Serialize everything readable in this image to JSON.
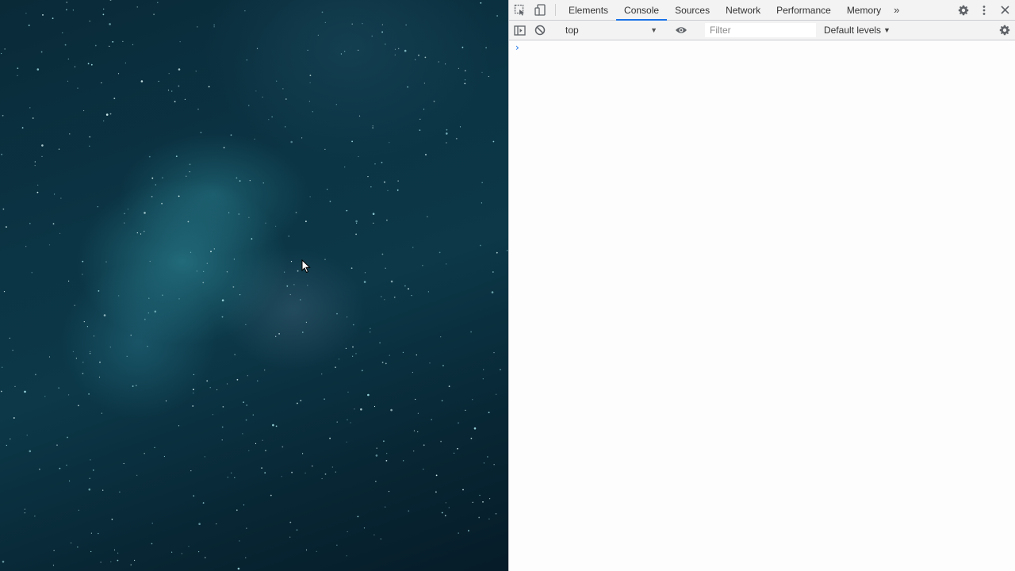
{
  "devtools": {
    "tabs": [
      {
        "label": "Elements"
      },
      {
        "label": "Console"
      },
      {
        "label": "Sources"
      },
      {
        "label": "Network"
      },
      {
        "label": "Performance"
      },
      {
        "label": "Memory"
      }
    ],
    "active_tab": "Console",
    "more_tabs_glyph": "»",
    "icons": {
      "inspect": "inspect-element-icon",
      "device": "device-toolbar-icon",
      "settings": "gear-icon",
      "menu": "kebab-menu-icon",
      "close": "close-icon"
    },
    "console_toolbar": {
      "context": "top",
      "filter_placeholder": "Filter",
      "levels_label": "Default levels"
    },
    "prompt_glyph": "›"
  },
  "colors": {
    "accent": "#1a73e8",
    "devtools_bg": "#f3f3f3",
    "page_bg": "#0b3444"
  }
}
